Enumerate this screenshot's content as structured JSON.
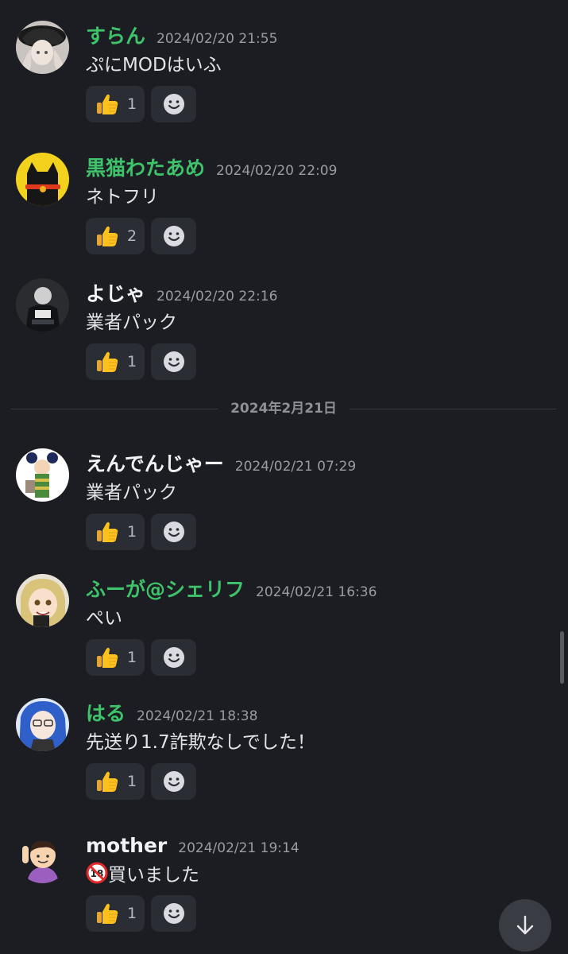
{
  "date_divider": "2024年2月21日",
  "messages": [
    {
      "username": "すらん",
      "name_color": "green",
      "timestamp": "2024/02/20 21:55",
      "content": "ぷにMODはいふ",
      "reaction": {
        "emoji": "thumbs-up",
        "count": "1"
      }
    },
    {
      "username": "黒猫わたあめ",
      "name_color": "green",
      "timestamp": "2024/02/20 22:09",
      "content": "ネトフリ",
      "reaction": {
        "emoji": "thumbs-up",
        "count": "2"
      }
    },
    {
      "username": "よじゃ",
      "name_color": "white",
      "timestamp": "2024/02/20 22:16",
      "content": "業者パック",
      "reaction": {
        "emoji": "thumbs-up",
        "count": "1"
      }
    },
    {
      "username": "えんでんじゃー",
      "name_color": "white",
      "timestamp": "2024/02/21 07:29",
      "content": "業者パック",
      "reaction": {
        "emoji": "thumbs-up",
        "count": "1"
      }
    },
    {
      "username": "ふーが@シェリフ",
      "name_color": "green",
      "timestamp": "2024/02/21 16:36",
      "content": "ぺい",
      "reaction": {
        "emoji": "thumbs-up",
        "count": "1"
      }
    },
    {
      "username": "はる",
      "name_color": "green",
      "timestamp": "2024/02/21 18:38",
      "content": "先送り1.7詐欺なしでした！",
      "reaction": {
        "emoji": "thumbs-up",
        "count": "1"
      }
    },
    {
      "username": "mother",
      "name_color": "white",
      "timestamp": "2024/02/21 19:14",
      "content": "買いました",
      "content_prefix_icon": "no-under-18-icon",
      "reaction": {
        "emoji": "thumbs-up",
        "count": "1"
      }
    }
  ],
  "colors": {
    "background": "#1c1d22",
    "name_green": "#3ec36a",
    "reaction_bg": "#2b2d34",
    "timestamp": "#9a9ca4"
  },
  "icons": {
    "add_reaction": "smiley-icon",
    "jump": "arrow-down-icon"
  }
}
